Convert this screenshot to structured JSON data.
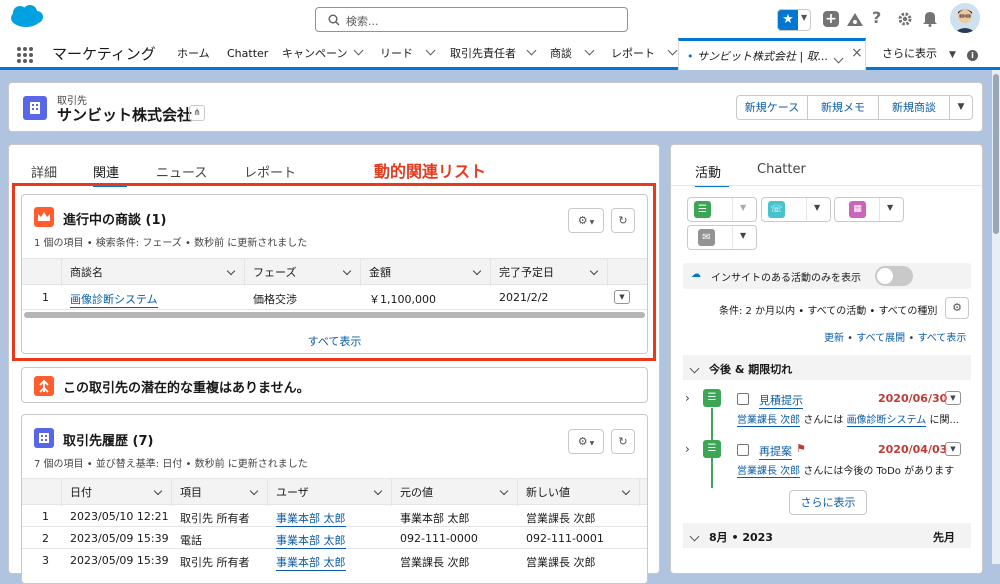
{
  "header": {
    "search_placeholder": "検索..."
  },
  "nav": {
    "app_name": "マーケティング",
    "items": [
      "ホーム",
      "Chatter",
      "キャンペーン",
      "リード",
      "取引先責任者",
      "商談",
      "レポート"
    ],
    "active_tab": "サンビット株式会社 | 取...",
    "more": "さらに表示"
  },
  "record": {
    "type_label": "取引先",
    "name": "サンビット株式会社",
    "actions": [
      "新規ケース",
      "新規メモ",
      "新規商談"
    ]
  },
  "tabs": [
    "詳細",
    "関連",
    "ニュース",
    "レポート"
  ],
  "annotation": "動的関連リスト",
  "opportunities": {
    "title": "進行中の商談 (1)",
    "subtitle": "1 個の項目 • 検索条件: フェーズ • 数秒前 に更新されました",
    "columns": [
      "商談名",
      "フェーズ",
      "金額",
      "完了予定日"
    ],
    "rows": [
      {
        "num": "1",
        "name": "画像診断システム",
        "phase": "価格交渉",
        "amount": "￥1,100,000",
        "date": "2021/2/2"
      }
    ],
    "view_all": "すべて表示"
  },
  "duplicate": {
    "text": "この取引先の潜在的な重複はありません。"
  },
  "history": {
    "title": "取引先履歴 (7)",
    "subtitle": "7 個の項目 • 並び替え基準: 日付 • 数秒前 に更新されました",
    "columns": [
      "日付",
      "項目",
      "ユーザ",
      "元の値",
      "新しい値"
    ],
    "rows": [
      {
        "num": "1",
        "date": "2023/05/10 12:21",
        "field": "取引先 所有者",
        "user": "事業本部 太郎",
        "old": "事業本部 太郎",
        "new": "営業課長 次郎"
      },
      {
        "num": "2",
        "date": "2023/05/09 15:39",
        "field": "電話",
        "user": "事業本部 太郎",
        "old": "092-111-0000",
        "new": "092-111-0001"
      },
      {
        "num": "3",
        "date": "2023/05/09 15:39",
        "field": "取引先 所有者",
        "user": "事業本部 太郎",
        "old": "営業課長 次郎",
        "new": "営業課長 次郎"
      }
    ]
  },
  "activity": {
    "tabs": [
      "活動",
      "Chatter"
    ],
    "insight_label": "インサイトのある活動のみを表示",
    "filter_text": "条件: 2 か月以内 • すべての活動 • すべての種別",
    "links": [
      "更新",
      "すべて展開",
      "すべて表示"
    ],
    "upcoming_header": "今後 & 期限切れ",
    "items": [
      {
        "title": "見積提示",
        "date": "2020/06/30",
        "user": "営業課長 次郎",
        "mid": "さんには",
        "link": "画像診断システム",
        "tail": "に関..."
      },
      {
        "title": "再提案",
        "date": "2020/04/03",
        "user": "営業課長 次郎",
        "mid": "さんには今後の ToDo があります",
        "link": "",
        "tail": ""
      }
    ],
    "more_button": "さらに表示",
    "month_header": "8月 • 2023",
    "month_right": "先月"
  },
  "colors": {
    "brand": "#0176d3",
    "link": "#0b5cab",
    "annotation": "#e8391d",
    "overdue": "#c23934",
    "task": "#3ba755",
    "event": "#cb65b9",
    "call": "#48c3cc",
    "opportunity": "#ff5d2d",
    "history": "#5867e8"
  }
}
